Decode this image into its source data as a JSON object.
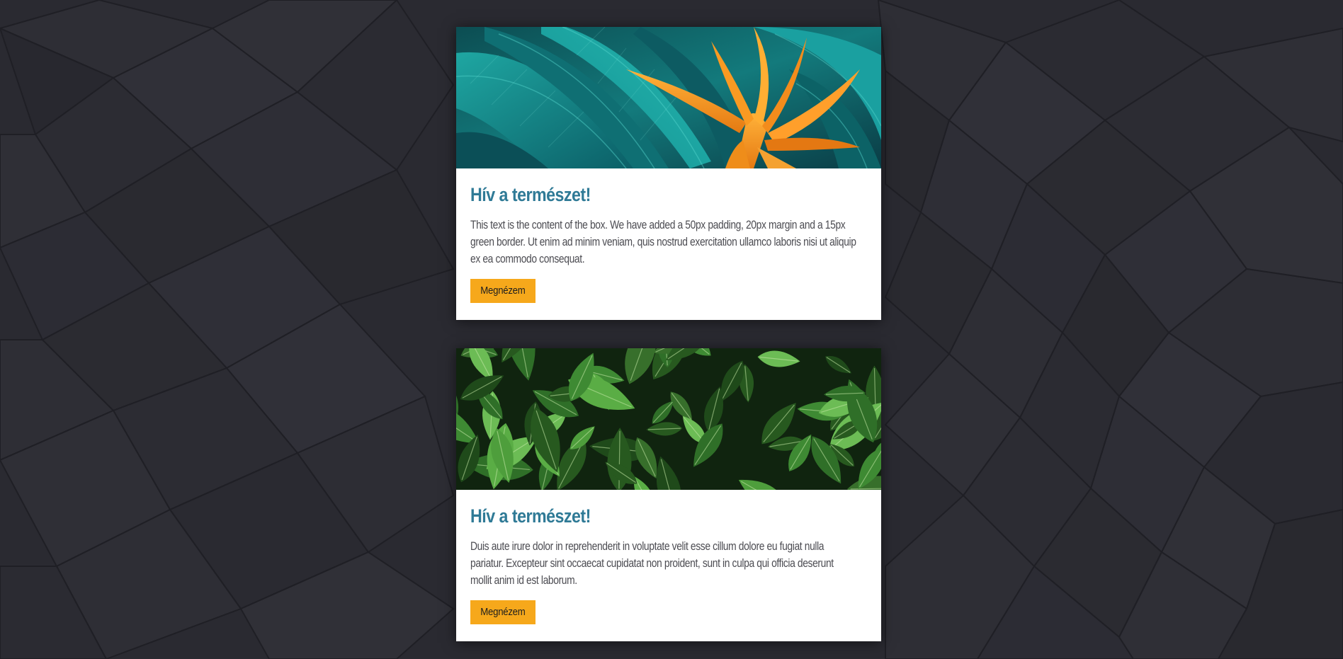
{
  "colors": {
    "background": "#2a2a31",
    "title": "#2f7a96",
    "button": "#f6a81b",
    "text": "#4c4c52"
  },
  "cards": [
    {
      "image_icon": "tropical-leaves-bird-of-paradise-image",
      "title": "Hív a természet!",
      "text": "This text is the content of the box. We have added a 50px padding, 20px margin and a 15px green border. Ut enim ad minim veniam, quis nostrud exercitation ullamco laboris nisi ut aliquip ex ea commodo consequat.",
      "button_label": "Megnézem"
    },
    {
      "image_icon": "green-foliage-image",
      "title": "Hív a természet!",
      "text": "Duis aute irure dolor in reprehenderit in voluptate velit esse cillum dolore eu fugiat nulla pariatur. Excepteur sint occaecat cupidatat non proident, sunt in culpa qui officia deserunt mollit anim id est laborum.",
      "button_label": "Megnézem"
    }
  ]
}
